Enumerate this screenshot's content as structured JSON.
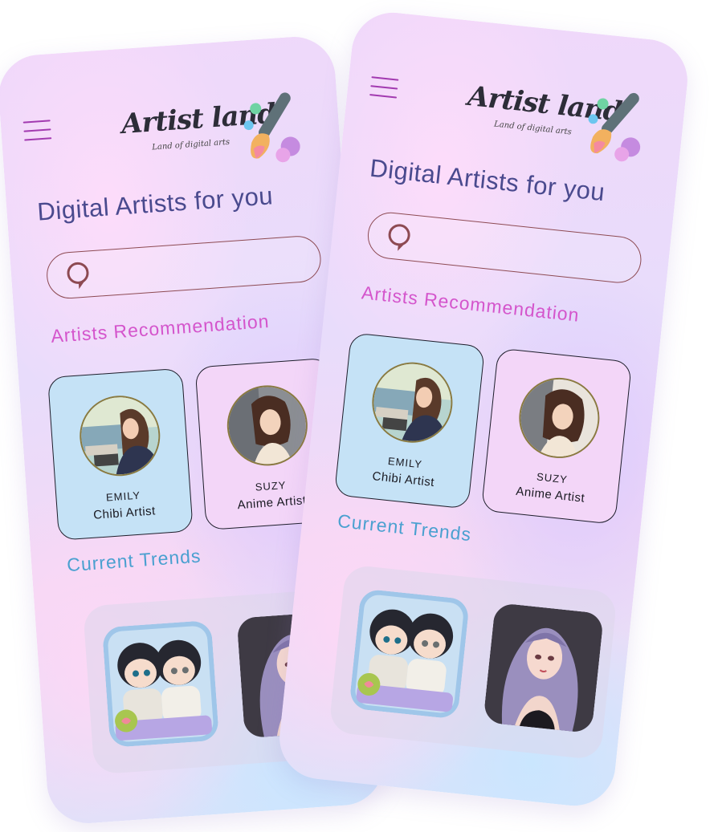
{
  "app": {
    "logo_title": "Artist land",
    "logo_tagline": "Land of digital arts",
    "heading": "Digital Artists for you"
  },
  "search": {
    "placeholder": ""
  },
  "sections": {
    "recommendations_title": "Artists Recommendation",
    "trends_title": "Current Trends"
  },
  "artists": [
    {
      "name": "EMILY",
      "role": "Chibi Artist",
      "card_color": "#c5e2f6"
    },
    {
      "name": "SUZY",
      "role": "Anime Artist",
      "card_color": "#f3d6f8"
    }
  ],
  "back_phone": {
    "second_card_role_partial": "An"
  },
  "trends": [
    {
      "icon": "chibi-boys-artwork"
    },
    {
      "icon": "anime-girl-portrait"
    }
  ],
  "colors": {
    "heading": "#4a4a8e",
    "recommendation_title": "#d455cc",
    "trends_title": "#4aa0d0",
    "menu": "#a23ab0",
    "search_border": "#8d4a52"
  }
}
